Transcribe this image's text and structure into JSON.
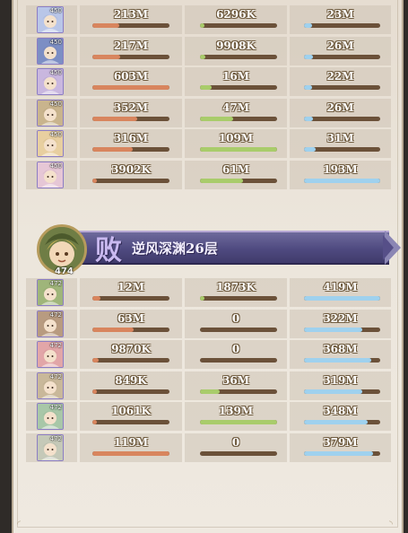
{
  "banner": {
    "result": "败",
    "stage": "逆风深渊26层",
    "level": "474",
    "avatar_icon": "hero-avatar-icon"
  },
  "colors": {
    "damage": "#d8855e",
    "damage_taken": "#a9cc6b",
    "healing": "#9fd1ee",
    "bar_track": "#6b5139"
  },
  "team_top": [
    {
      "level": "450",
      "palette": "#b9c6e8",
      "damage": "213M",
      "damage_fill": 0.35,
      "taken": "6296K",
      "taken_fill": 0.05,
      "heal": "23M",
      "heal_fill": 0.1
    },
    {
      "level": "450",
      "palette": "#7c8ec4",
      "damage": "217M",
      "damage_fill": 0.36,
      "taken": "9908K",
      "taken_fill": 0.07,
      "heal": "26M",
      "heal_fill": 0.12
    },
    {
      "level": "450",
      "palette": "#c9b7df",
      "damage": "603M",
      "damage_fill": 1.0,
      "taken": "16M",
      "taken_fill": 0.15,
      "heal": "22M",
      "heal_fill": 0.1
    },
    {
      "level": "450",
      "palette": "#c9b48d",
      "damage": "352M",
      "damage_fill": 0.58,
      "taken": "47M",
      "taken_fill": 0.43,
      "heal": "26M",
      "heal_fill": 0.12
    },
    {
      "level": "450",
      "palette": "#e8cfa0",
      "damage": "316M",
      "damage_fill": 0.52,
      "taken": "109M",
      "taken_fill": 1.0,
      "heal": "31M",
      "heal_fill": 0.15
    },
    {
      "level": "450",
      "palette": "#e6c7d6",
      "damage": "3902K",
      "damage_fill": 0.01,
      "taken": "61M",
      "taken_fill": 0.56,
      "heal": "193M",
      "heal_fill": 1.0
    }
  ],
  "team_bottom": [
    {
      "level": "472",
      "palette": "#9fb57a",
      "damage": "12M",
      "damage_fill": 0.1,
      "taken": "1873K",
      "taken_fill": 0.01,
      "heal": "419M",
      "heal_fill": 1.0
    },
    {
      "level": "472",
      "palette": "#b89b80",
      "damage": "63M",
      "damage_fill": 0.53,
      "taken": "0",
      "taken_fill": 0.0,
      "heal": "322M",
      "heal_fill": 0.77
    },
    {
      "level": "472",
      "palette": "#e2a6a8",
      "damage": "9870K",
      "damage_fill": 0.08,
      "taken": "0",
      "taken_fill": 0.0,
      "heal": "368M",
      "heal_fill": 0.88
    },
    {
      "level": "472",
      "palette": "#c9b89a",
      "damage": "849K",
      "damage_fill": 0.01,
      "taken": "36M",
      "taken_fill": 0.26,
      "heal": "319M",
      "heal_fill": 0.76
    },
    {
      "level": "472",
      "palette": "#a8c7a8",
      "damage": "1061K",
      "damage_fill": 0.01,
      "taken": "139M",
      "taken_fill": 1.0,
      "heal": "348M",
      "heal_fill": 0.83
    },
    {
      "level": "472",
      "palette": "#c5c9b8",
      "damage": "119M",
      "damage_fill": 1.0,
      "taken": "0",
      "taken_fill": 0.0,
      "heal": "379M",
      "heal_fill": 0.9
    }
  ]
}
